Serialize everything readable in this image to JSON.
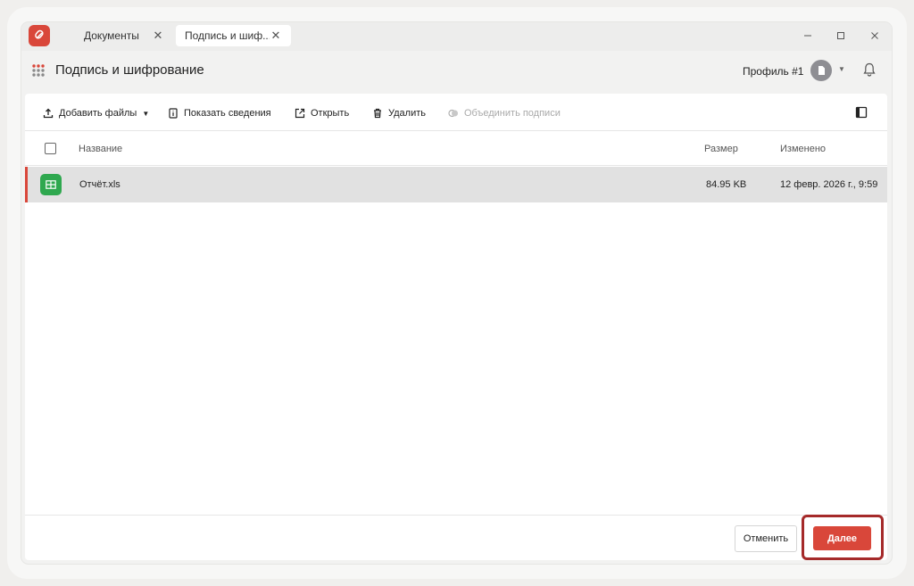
{
  "tabs": [
    {
      "label": "Документы"
    },
    {
      "label": "Подпись и шиф..."
    }
  ],
  "header": {
    "title": "Подпись и шифрование",
    "profile": "Профиль #1"
  },
  "toolbar": {
    "add_files": "Добавить файлы",
    "show_info": "Показать сведения",
    "open": "Открыть",
    "delete": "Удалить",
    "merge_signatures": "Объединить подписи"
  },
  "table": {
    "columns": {
      "name": "Название",
      "size": "Размер",
      "modified": "Изменено"
    },
    "rows": [
      {
        "name": "Отчёт.xls",
        "size": "84.95 KB",
        "modified": "12 февр. 2026 г., 9:59"
      }
    ]
  },
  "footer": {
    "cancel": "Отменить",
    "next": "Далее"
  },
  "colors": {
    "accent": "#d9473a",
    "file_icon": "#2fa84f",
    "highlight": "#a52a2a"
  },
  "icons": [
    "app-logo-icon",
    "close-icon",
    "minimize-icon",
    "maximize-icon",
    "apps-grid-icon",
    "avatar-icon",
    "chevron-down-icon",
    "bell-icon",
    "upload-icon",
    "info-icon",
    "external-link-icon",
    "trash-icon",
    "merge-icon",
    "side-panel-icon",
    "spreadsheet-icon"
  ]
}
